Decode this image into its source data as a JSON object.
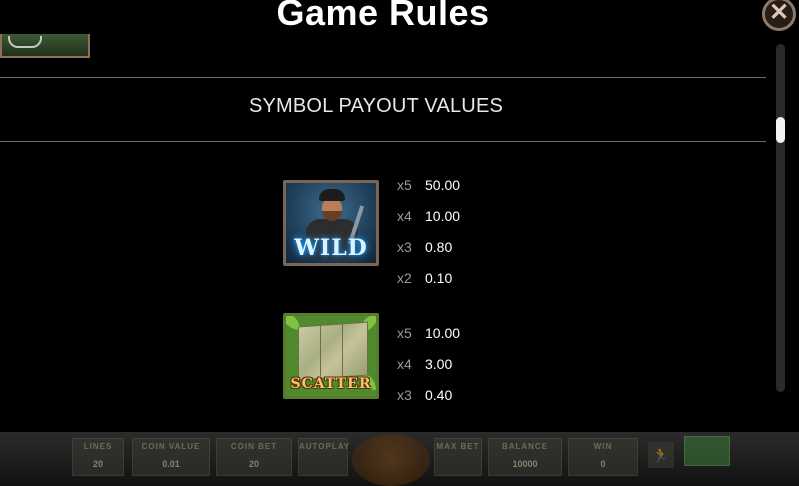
{
  "modal": {
    "title": "Game Rules",
    "close_icon": "close-x-icon",
    "section_title": "SYMBOL PAYOUT VALUES"
  },
  "symbols": [
    {
      "name": "WILD",
      "icon": "wild-symbol-icon",
      "payouts": [
        {
          "count": "x5",
          "value": "50.00"
        },
        {
          "count": "x4",
          "value": "10.00"
        },
        {
          "count": "x3",
          "value": "0.80"
        },
        {
          "count": "x2",
          "value": "0.10"
        }
      ]
    },
    {
      "name": "SCATTER",
      "icon": "scatter-symbol-icon",
      "payouts": [
        {
          "count": "x5",
          "value": "10.00"
        },
        {
          "count": "x4",
          "value": "3.00"
        },
        {
          "count": "x3",
          "value": "0.40"
        }
      ]
    }
  ],
  "scrollbar": {
    "position": 0.2
  },
  "bottom_bar": {
    "lines_label": "LINES",
    "lines_value": "20",
    "coin_value_label": "COIN VALUE",
    "coin_value": "0.01",
    "coin_bet_label": "COIN BET",
    "coin_bet_value": "20",
    "autoplay_label": "AUTOPLAY",
    "max_bet_label": "MAX BET",
    "balance_label": "BALANCE",
    "balance_value": "10000",
    "win_label": "WIN",
    "win_value": "0",
    "colors": {
      "accent_green": "#3a7a3a",
      "logo": "#7a4a16"
    }
  }
}
